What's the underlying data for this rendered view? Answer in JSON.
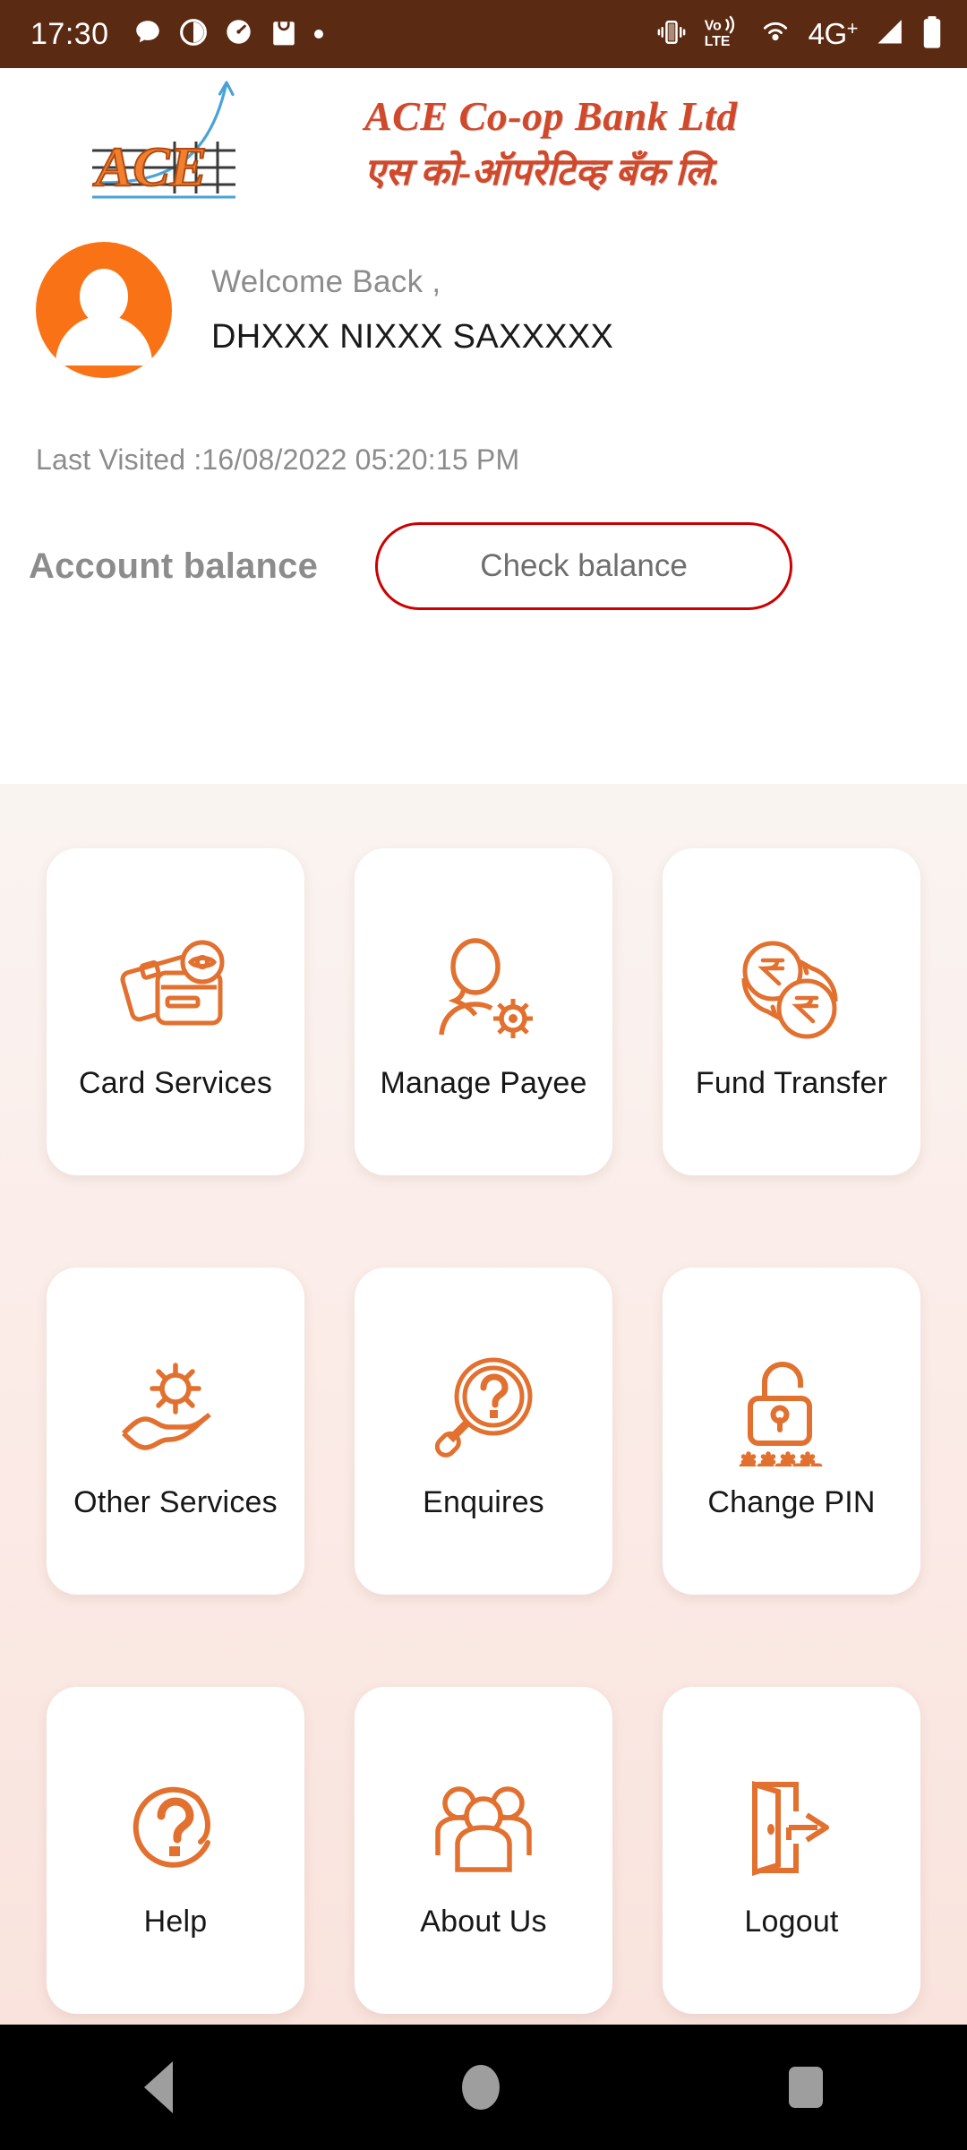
{
  "status_bar": {
    "time": "17:30",
    "network_label": "4G",
    "network_sup": "+",
    "left_icons": [
      "chat-bubble-icon",
      "pie-chart-icon",
      "speedometer-icon",
      "shopping-bag-icon",
      "dot-icon"
    ],
    "right_icons": [
      "vibrate-icon",
      "volte-icon",
      "hotspot-icon",
      "network-4g-plus-label",
      "signal-bars-icon",
      "battery-icon"
    ],
    "volte_top": "Vo",
    "volte_bottom": "LTE",
    "background_color": "#5b2a12"
  },
  "header": {
    "logo_mark_text": "ACE",
    "bank_name_en": "ACE  Co-op Bank Ltd",
    "bank_name_mr": "एस  को-ऑपरेटिव्ह  बँक  लि.",
    "logo_color": "#d1492b"
  },
  "welcome": {
    "greeting": "Welcome Back ,",
    "user_name": "DHXXX NIXXX SAXXXXX",
    "avatar_icon": "user-avatar-icon",
    "avatar_color": "#f97316"
  },
  "last_visited": "Last Visited :16/08/2022 05:20:15 PM",
  "balance": {
    "label": "Account balance",
    "check_button": "Check balance",
    "button_border_color": "#cc0000"
  },
  "menu": {
    "accent_color": "#e2702f",
    "tiles": [
      {
        "label": "Card Services",
        "icon": "credit-cards-eye-icon"
      },
      {
        "label": "Manage Payee",
        "icon": "person-gear-icon"
      },
      {
        "label": "Fund Transfer",
        "icon": "rupee-coins-transfer-icon"
      },
      {
        "label": "Other Services",
        "icon": "hand-gear-icon"
      },
      {
        "label": "Enquires",
        "icon": "magnifier-question-icon"
      },
      {
        "label": "Change PIN",
        "icon": "open-padlock-asterisks-icon"
      },
      {
        "label": "Help",
        "icon": "question-circle-icon"
      },
      {
        "label": "About Us",
        "icon": "people-group-icon"
      },
      {
        "label": "Logout",
        "icon": "door-exit-icon"
      }
    ]
  },
  "navbar": {
    "back": "back-triangle-icon",
    "home": "home-circle-icon",
    "recents": "recents-square-icon"
  }
}
